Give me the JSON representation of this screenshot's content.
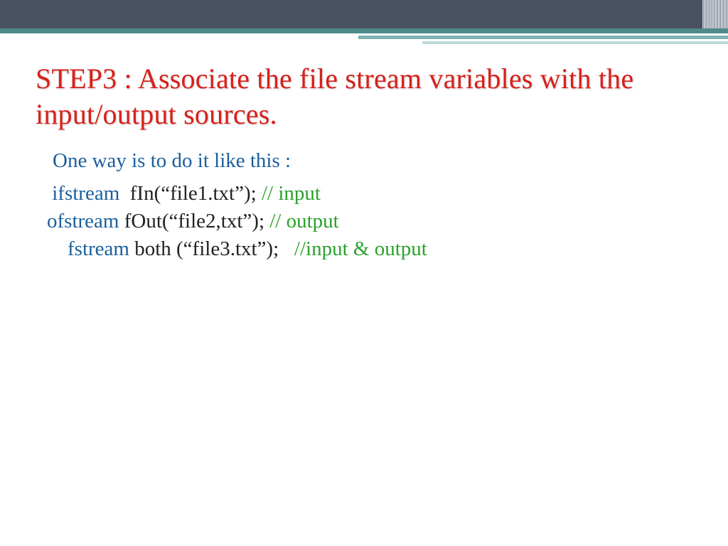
{
  "title": {
    "label": "STEP3 : ",
    "rest": "Associate the file stream variables with the input/output sources."
  },
  "sub": "One way is to do it like this :",
  "code": {
    "rows": [
      {
        "indent": " ",
        "kw": "ifstream",
        "gap": "  ",
        "id": "fIn(“file1.txt”); ",
        "cmt": "// input"
      },
      {
        "indent": "",
        "kw": "ofstream",
        "gap": " ",
        "id": "fOut(“file2,txt”); ",
        "cmt": "// output"
      },
      {
        "indent": "    ",
        "kw": "fstream",
        "gap": " ",
        "id": "both (“file3.txt”);   ",
        "cmt": "//input & output"
      }
    ]
  }
}
